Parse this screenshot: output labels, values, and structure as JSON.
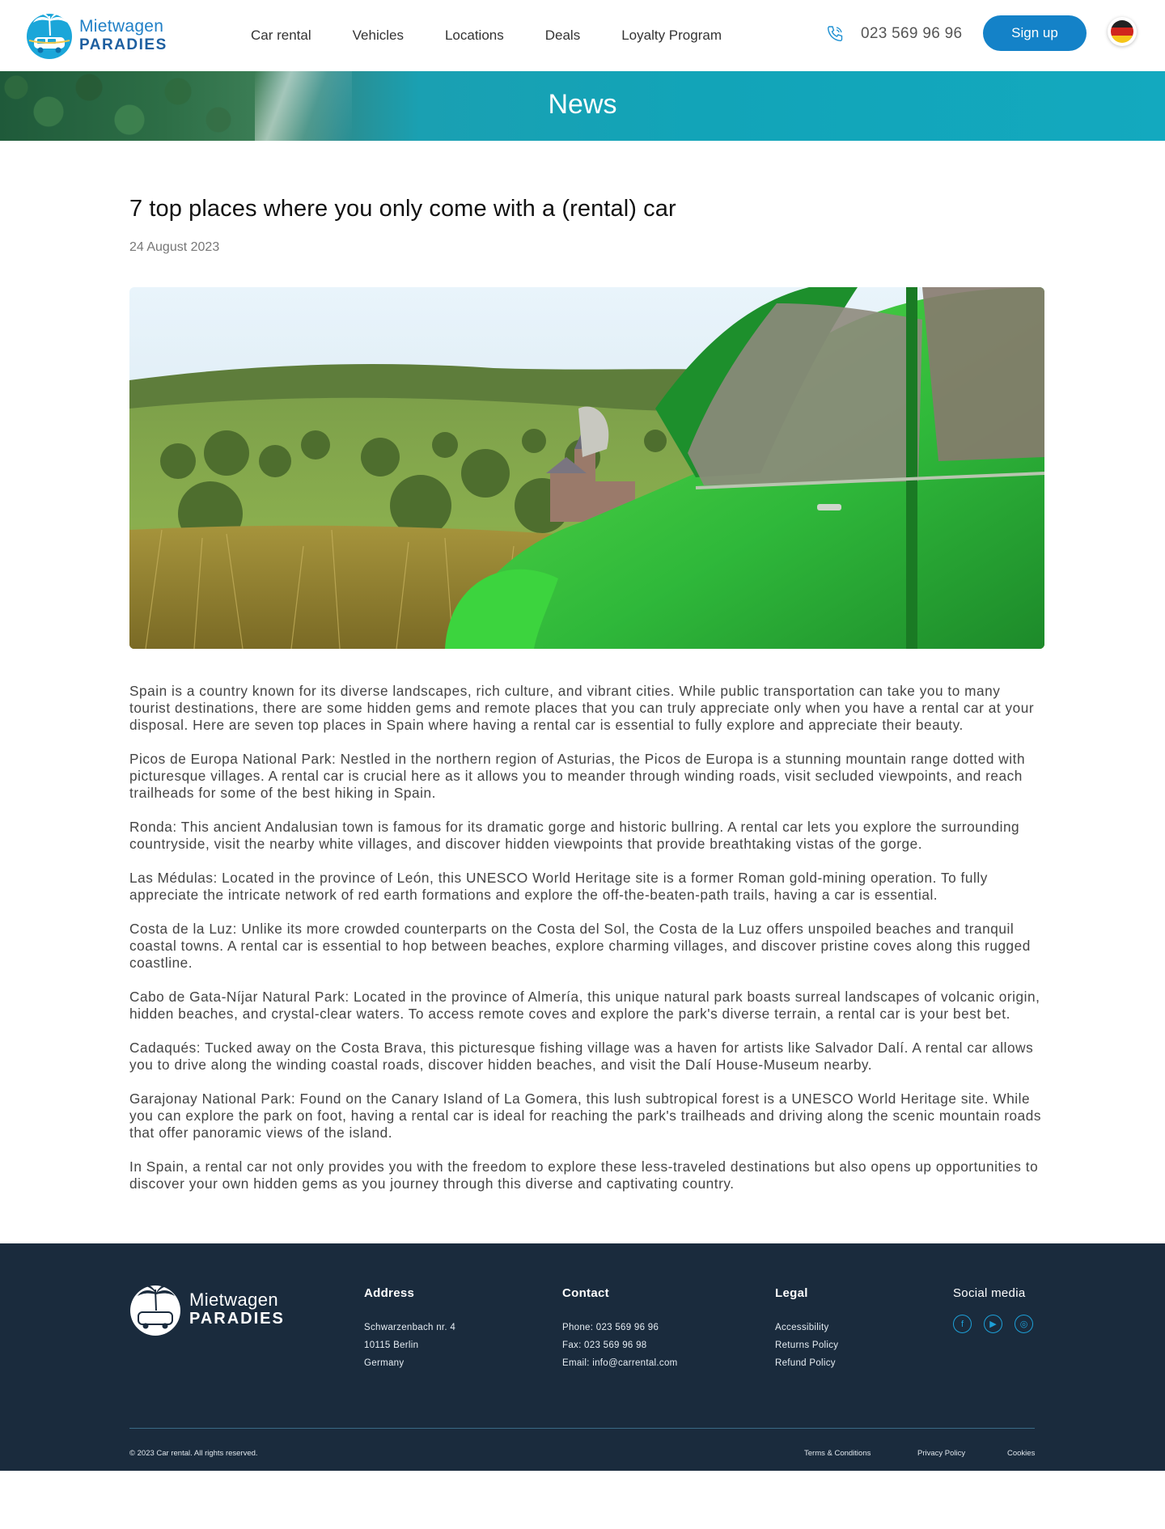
{
  "header": {
    "logo_line1": "Mietwagen",
    "logo_line2": "PARADIES",
    "nav": [
      "Car rental",
      "Vehicles",
      "Locations",
      "Deals",
      "Loyalty Program"
    ],
    "phone": "023 569 96 96",
    "signup_label": "Sign up",
    "language": "German",
    "accent_color": "#1482c8"
  },
  "banner": {
    "title": "News"
  },
  "article": {
    "title": "7 top places where you only come with a (rental) car",
    "date": "24 August 2023",
    "paragraphs": [
      "Spain is a country known for its diverse landscapes, rich culture, and vibrant cities. While public transportation can take you to many tourist destinations, there are some hidden gems and remote places that you can truly appreciate only when you have a rental car at your disposal. Here are seven top places in Spain where having a rental car is essential to fully explore and appreciate their beauty.",
      "Picos de Europa National Park: Nestled in the northern region of Asturias, the Picos de Europa is a stunning mountain range dotted with picturesque villages. A rental car is crucial here as it allows you to meander through winding roads, visit secluded viewpoints, and reach trailheads for some of the best hiking in Spain.",
      "Ronda: This ancient Andalusian town is famous for its dramatic gorge and historic bullring. A rental car lets you explore the surrounding countryside, visit the nearby white villages, and discover hidden viewpoints that provide breathtaking vistas of the gorge.",
      "Las Médulas: Located in the province of León, this UNESCO World Heritage site is a former Roman gold-mining operation. To fully appreciate the intricate network of red earth formations and explore the off-the-beaten-path trails, having a car is essential.",
      "Costa de la Luz: Unlike its more crowded counterparts on the Costa del Sol, the Costa de la Luz offers unspoiled beaches and tranquil coastal towns. A rental car is essential to hop between beaches, explore charming villages, and discover pristine coves along this rugged coastline.",
      "Cabo de Gata-Níjar Natural Park: Located in the province of Almería, this unique natural park boasts surreal landscapes of volcanic origin, hidden beaches, and crystal-clear waters. To access remote coves and explore the park's diverse terrain, a rental car is your best bet.",
      "Cadaqués: Tucked away on the Costa Brava, this picturesque fishing village was a haven for artists like Salvador Dalí. A rental car allows you to drive along the winding coastal roads, discover hidden beaches, and visit the Dalí House-Museum nearby.",
      "Garajonay National Park: Found on the Canary Island of La Gomera, this lush subtropical forest is a UNESCO World Heritage site. While you can explore the park on foot, having a rental car is ideal for reaching the park's trailheads and driving along the scenic mountain roads that offer panoramic views of the island.",
      "In Spain, a rental car not only provides you with the freedom to explore these less-traveled destinations but also opens up opportunities to discover your own hidden gems as you journey through this diverse and captivating country."
    ]
  },
  "footer": {
    "logo_line1": "Mietwagen",
    "logo_line2": "PARADIES",
    "address": {
      "heading": "Address",
      "lines": [
        "Schwarzenbach nr. 4",
        "10115 Berlin",
        "Germany"
      ]
    },
    "contact": {
      "heading": "Contact",
      "lines": [
        "Phone: 023 569 96 96",
        "Fax: 023 569 96 98",
        "Email: info@carrental.com"
      ]
    },
    "legal": {
      "heading": "Legal",
      "lines": [
        "Accessibility",
        "Returns Policy",
        "Refund Policy"
      ]
    },
    "social": {
      "heading": "Social media",
      "icons": [
        "facebook-icon",
        "youtube-icon",
        "instagram-icon"
      ]
    },
    "copyright": "© 2023 Car rental. All rights reserved.",
    "bottom_links": [
      "Terms & Conditions",
      "Privacy Policy",
      "Cookies"
    ],
    "background_color": "#1a2b3d"
  }
}
